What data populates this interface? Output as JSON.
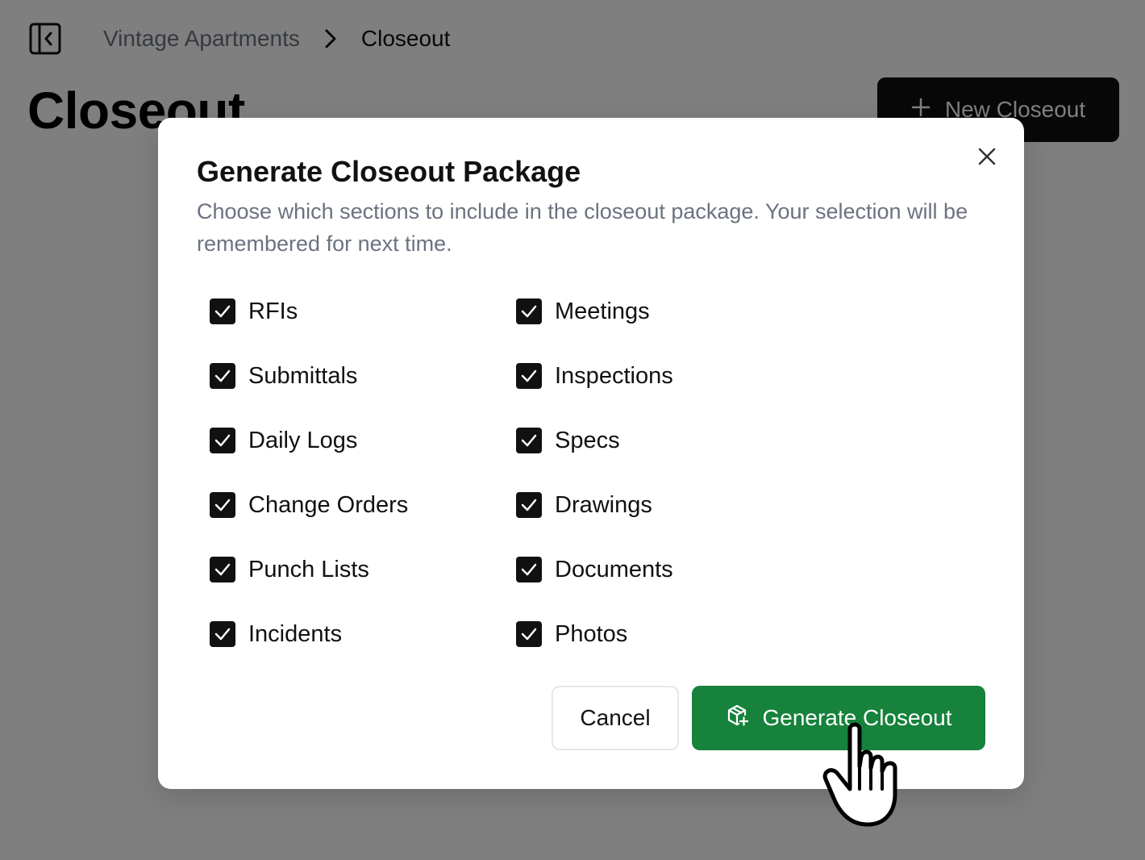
{
  "breadcrumb": {
    "parent": "Vintage Apartments",
    "current": "Closeout"
  },
  "page": {
    "title": "Closeout",
    "new_button_label": "New Closeout"
  },
  "modal": {
    "title": "Generate Closeout Package",
    "description": "Choose which sections to include in the closeout package. Your selection will be remembered for next time.",
    "options": [
      {
        "label": "RFIs",
        "checked": true
      },
      {
        "label": "Meetings",
        "checked": true
      },
      {
        "label": "Submittals",
        "checked": true
      },
      {
        "label": "Inspections",
        "checked": true
      },
      {
        "label": "Daily Logs",
        "checked": true
      },
      {
        "label": "Specs",
        "checked": true
      },
      {
        "label": "Change Orders",
        "checked": true
      },
      {
        "label": "Drawings",
        "checked": true
      },
      {
        "label": "Punch Lists",
        "checked": true
      },
      {
        "label": "Documents",
        "checked": true
      },
      {
        "label": "Incidents",
        "checked": true
      },
      {
        "label": "Photos",
        "checked": true
      }
    ],
    "cancel_label": "Cancel",
    "generate_label": "Generate Closeout"
  },
  "icons": {
    "sidebar_toggle": "sidebar-collapse-icon",
    "breadcrumb_separator": "chevron-right-icon",
    "new": "plus-icon",
    "close": "close-icon",
    "generate": "package-plus-icon",
    "checkbox": "check-icon",
    "cursor": "hand-pointer-icon"
  },
  "colors": {
    "primary_dark": "#111111",
    "generate_green": "#16823b",
    "overlay": "rgba(0,0,0,0.5)",
    "muted_text": "#6b7280"
  }
}
